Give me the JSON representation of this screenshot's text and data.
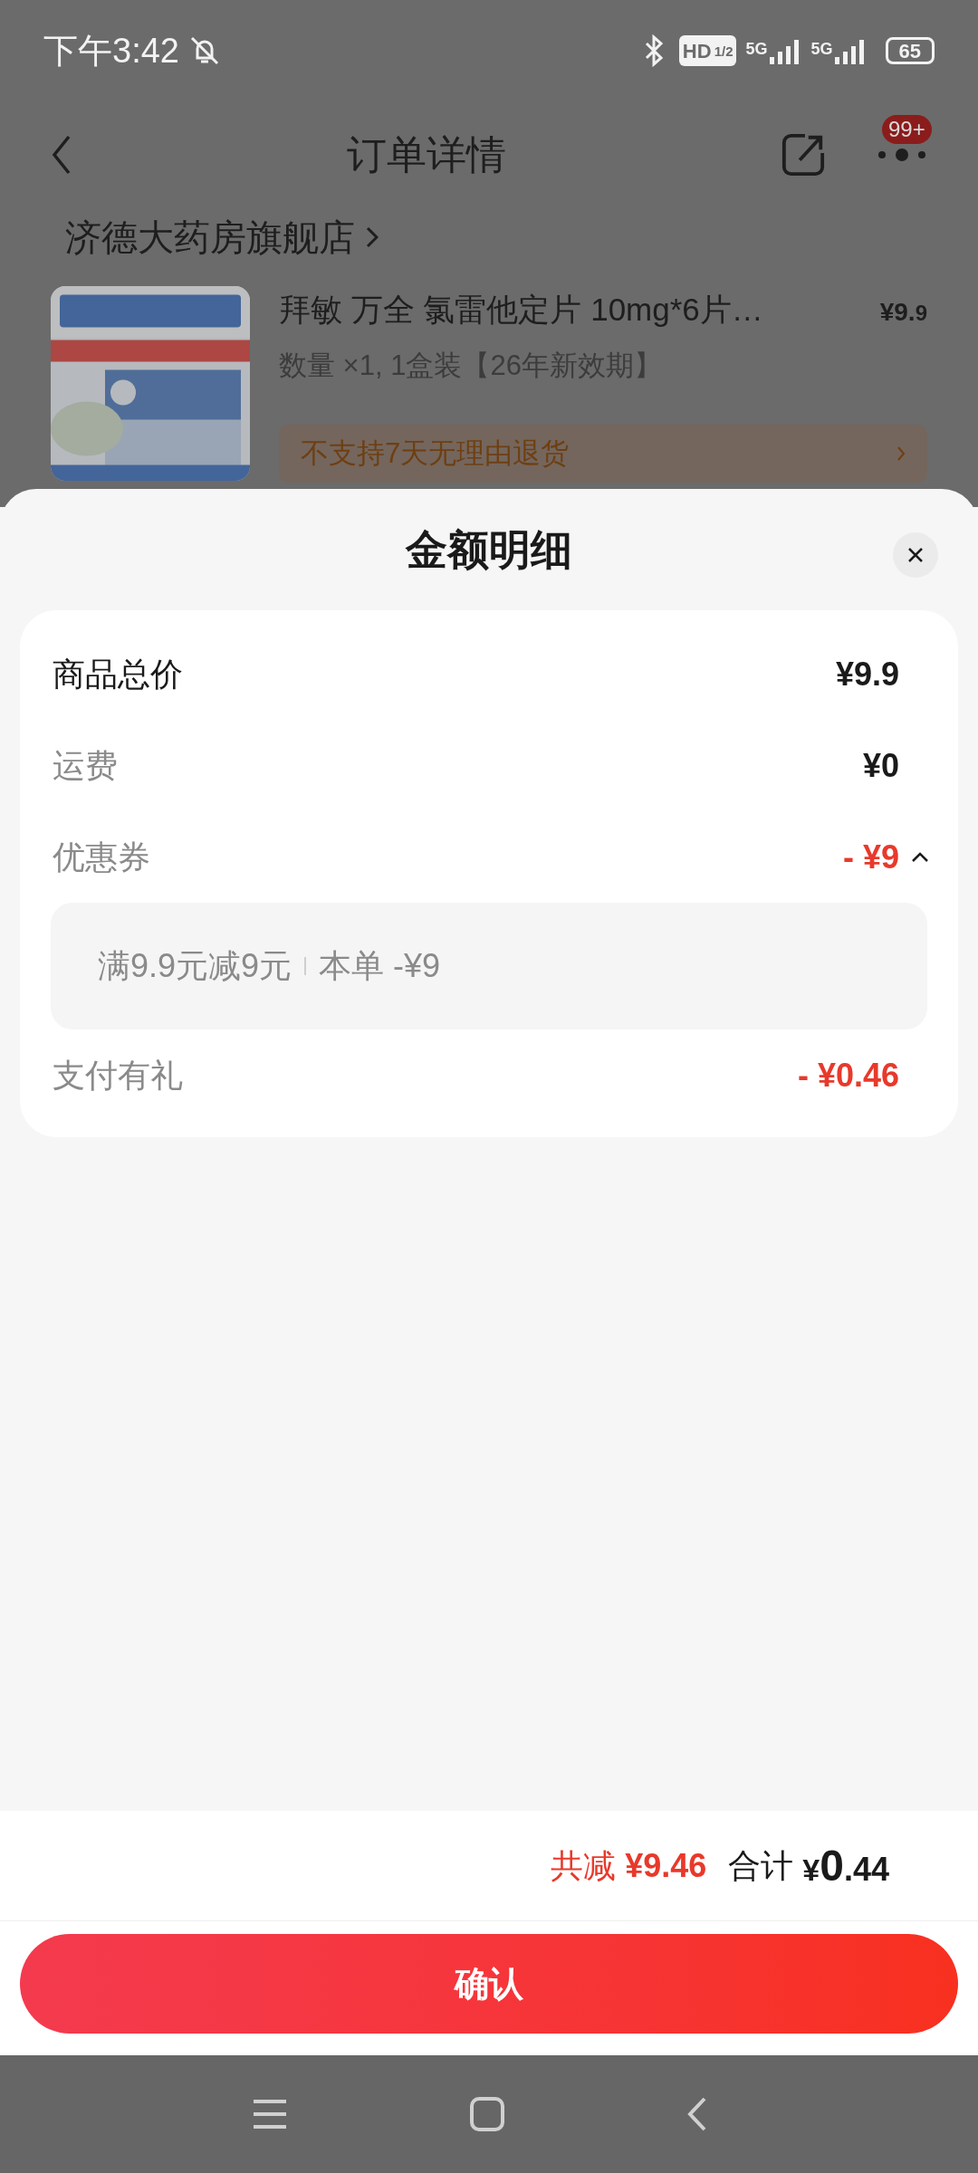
{
  "status_bar": {
    "time": "下午3:42",
    "hd": "HD",
    "hd_sub": "1/2",
    "networks": [
      "5G",
      "5G"
    ],
    "battery": "65"
  },
  "header": {
    "title": "订单详情",
    "badge": "99+"
  },
  "store": {
    "name": "济德大药房旗舰店"
  },
  "product": {
    "title": "拜敏 万全 氯雷他定片 10mg*6片…",
    "price_integer": "¥9.",
    "price_decimal": "9",
    "spec": "数量 ×1, 1盒装【26年新效期】",
    "notice": "不支持7天无理由退货"
  },
  "sheet": {
    "title": "金额明细",
    "rows": [
      {
        "kind": "total",
        "label": "商品总价",
        "value": "¥9.9"
      },
      {
        "kind": "fee",
        "label": "运费",
        "value": "¥0"
      },
      {
        "kind": "discount",
        "label": "优惠券",
        "value": "- ¥9",
        "expanded": true,
        "detail": {
          "rule": "满9.9元减9元",
          "amount": "本单 -¥9"
        }
      },
      {
        "kind": "discount",
        "label": "支付有礼",
        "value": "- ¥0.46"
      }
    ]
  },
  "footer": {
    "saved_label": "共减",
    "saved_value": "¥9.46",
    "total_label": "合计",
    "total_symbol": "¥",
    "total_integer": "0",
    "total_decimal": ".44",
    "confirm": "确认"
  }
}
